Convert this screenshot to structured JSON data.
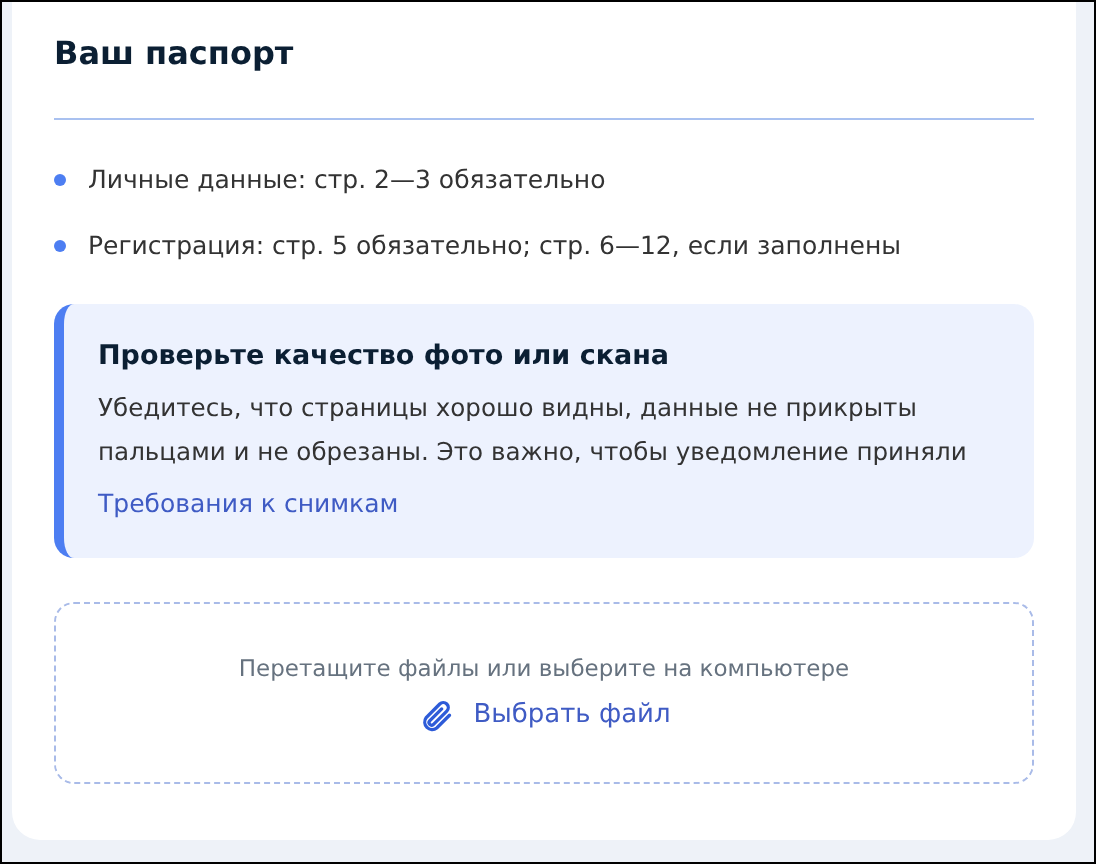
{
  "title": "Ваш паспорт",
  "requirements": [
    "Личные данные: стр. 2—3 обязательно",
    "Регистрация: стр. 5 обязательно; стр. 6—12, если заполнены"
  ],
  "notice": {
    "title": "Проверьте качество фото или скана",
    "text": "Убедитесь, что страницы хорошо видны, данные не прикрыты пальцами и не обрезаны. Это важно, чтобы уведомление приняли",
    "link": "Требования к снимкам"
  },
  "upload": {
    "hint": "Перетащите файлы или выберите на компьютере",
    "button": "Выбрать файл"
  }
}
